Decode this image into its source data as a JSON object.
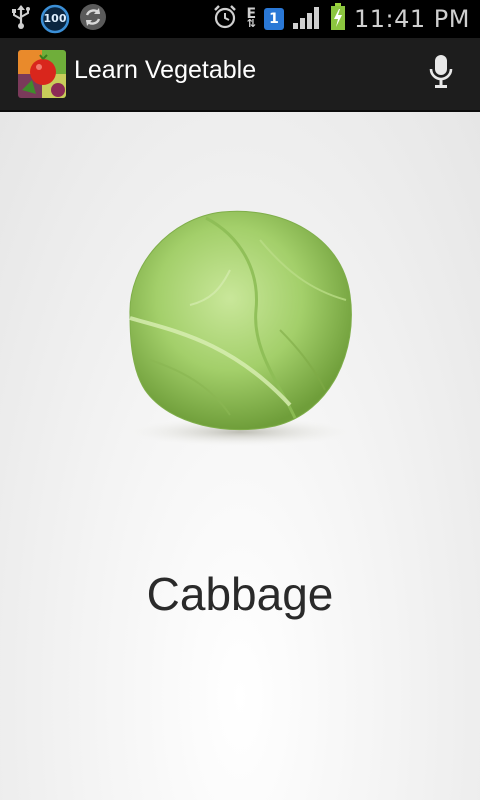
{
  "status_bar": {
    "time": "11:41 PM",
    "notification_badge": "100",
    "sim_label": "1",
    "network_type": "E",
    "icons": [
      "usb-icon",
      "badge-100-icon",
      "sync-icon",
      "alarm-icon",
      "data-edge-icon",
      "sim-icon",
      "signal-icon",
      "battery-charging-icon"
    ]
  },
  "action_bar": {
    "title": "Learn Vegetable",
    "app_icon": "vegetables-app-icon",
    "action_icon": "microphone-icon"
  },
  "main": {
    "image": "cabbage-image",
    "vegetable_name": "Cabbage"
  }
}
